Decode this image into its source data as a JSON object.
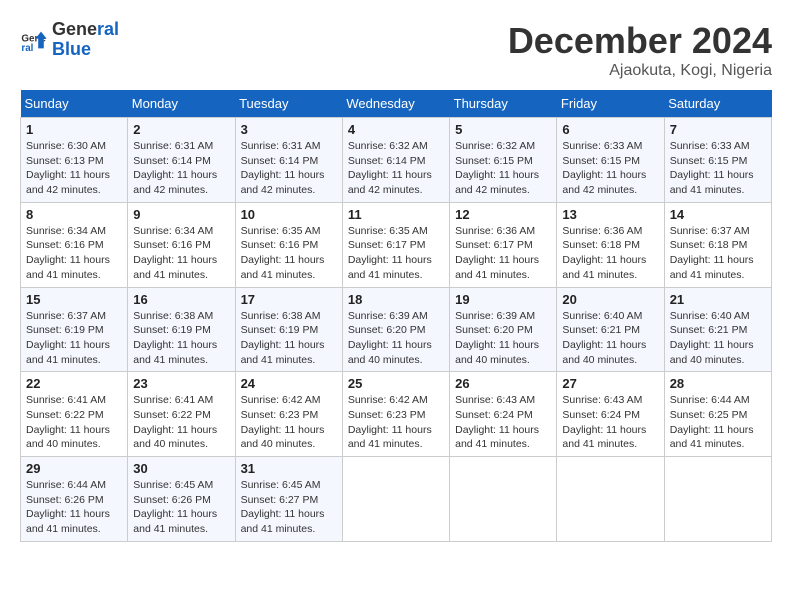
{
  "header": {
    "logo_line1": "General",
    "logo_line2": "Blue",
    "month": "December 2024",
    "location": "Ajaokuta, Kogi, Nigeria"
  },
  "weekdays": [
    "Sunday",
    "Monday",
    "Tuesday",
    "Wednesday",
    "Thursday",
    "Friday",
    "Saturday"
  ],
  "weeks": [
    [
      {
        "day": "1",
        "lines": [
          "Sunrise: 6:30 AM",
          "Sunset: 6:13 PM",
          "Daylight: 11 hours",
          "and 42 minutes."
        ]
      },
      {
        "day": "2",
        "lines": [
          "Sunrise: 6:31 AM",
          "Sunset: 6:14 PM",
          "Daylight: 11 hours",
          "and 42 minutes."
        ]
      },
      {
        "day": "3",
        "lines": [
          "Sunrise: 6:31 AM",
          "Sunset: 6:14 PM",
          "Daylight: 11 hours",
          "and 42 minutes."
        ]
      },
      {
        "day": "4",
        "lines": [
          "Sunrise: 6:32 AM",
          "Sunset: 6:14 PM",
          "Daylight: 11 hours",
          "and 42 minutes."
        ]
      },
      {
        "day": "5",
        "lines": [
          "Sunrise: 6:32 AM",
          "Sunset: 6:15 PM",
          "Daylight: 11 hours",
          "and 42 minutes."
        ]
      },
      {
        "day": "6",
        "lines": [
          "Sunrise: 6:33 AM",
          "Sunset: 6:15 PM",
          "Daylight: 11 hours",
          "and 42 minutes."
        ]
      },
      {
        "day": "7",
        "lines": [
          "Sunrise: 6:33 AM",
          "Sunset: 6:15 PM",
          "Daylight: 11 hours",
          "and 41 minutes."
        ]
      }
    ],
    [
      {
        "day": "8",
        "lines": [
          "Sunrise: 6:34 AM",
          "Sunset: 6:16 PM",
          "Daylight: 11 hours",
          "and 41 minutes."
        ]
      },
      {
        "day": "9",
        "lines": [
          "Sunrise: 6:34 AM",
          "Sunset: 6:16 PM",
          "Daylight: 11 hours",
          "and 41 minutes."
        ]
      },
      {
        "day": "10",
        "lines": [
          "Sunrise: 6:35 AM",
          "Sunset: 6:16 PM",
          "Daylight: 11 hours",
          "and 41 minutes."
        ]
      },
      {
        "day": "11",
        "lines": [
          "Sunrise: 6:35 AM",
          "Sunset: 6:17 PM",
          "Daylight: 11 hours",
          "and 41 minutes."
        ]
      },
      {
        "day": "12",
        "lines": [
          "Sunrise: 6:36 AM",
          "Sunset: 6:17 PM",
          "Daylight: 11 hours",
          "and 41 minutes."
        ]
      },
      {
        "day": "13",
        "lines": [
          "Sunrise: 6:36 AM",
          "Sunset: 6:18 PM",
          "Daylight: 11 hours",
          "and 41 minutes."
        ]
      },
      {
        "day": "14",
        "lines": [
          "Sunrise: 6:37 AM",
          "Sunset: 6:18 PM",
          "Daylight: 11 hours",
          "and 41 minutes."
        ]
      }
    ],
    [
      {
        "day": "15",
        "lines": [
          "Sunrise: 6:37 AM",
          "Sunset: 6:19 PM",
          "Daylight: 11 hours",
          "and 41 minutes."
        ]
      },
      {
        "day": "16",
        "lines": [
          "Sunrise: 6:38 AM",
          "Sunset: 6:19 PM",
          "Daylight: 11 hours",
          "and 41 minutes."
        ]
      },
      {
        "day": "17",
        "lines": [
          "Sunrise: 6:38 AM",
          "Sunset: 6:19 PM",
          "Daylight: 11 hours",
          "and 41 minutes."
        ]
      },
      {
        "day": "18",
        "lines": [
          "Sunrise: 6:39 AM",
          "Sunset: 6:20 PM",
          "Daylight: 11 hours",
          "and 40 minutes."
        ]
      },
      {
        "day": "19",
        "lines": [
          "Sunrise: 6:39 AM",
          "Sunset: 6:20 PM",
          "Daylight: 11 hours",
          "and 40 minutes."
        ]
      },
      {
        "day": "20",
        "lines": [
          "Sunrise: 6:40 AM",
          "Sunset: 6:21 PM",
          "Daylight: 11 hours",
          "and 40 minutes."
        ]
      },
      {
        "day": "21",
        "lines": [
          "Sunrise: 6:40 AM",
          "Sunset: 6:21 PM",
          "Daylight: 11 hours",
          "and 40 minutes."
        ]
      }
    ],
    [
      {
        "day": "22",
        "lines": [
          "Sunrise: 6:41 AM",
          "Sunset: 6:22 PM",
          "Daylight: 11 hours",
          "and 40 minutes."
        ]
      },
      {
        "day": "23",
        "lines": [
          "Sunrise: 6:41 AM",
          "Sunset: 6:22 PM",
          "Daylight: 11 hours",
          "and 40 minutes."
        ]
      },
      {
        "day": "24",
        "lines": [
          "Sunrise: 6:42 AM",
          "Sunset: 6:23 PM",
          "Daylight: 11 hours",
          "and 40 minutes."
        ]
      },
      {
        "day": "25",
        "lines": [
          "Sunrise: 6:42 AM",
          "Sunset: 6:23 PM",
          "Daylight: 11 hours",
          "and 41 minutes."
        ]
      },
      {
        "day": "26",
        "lines": [
          "Sunrise: 6:43 AM",
          "Sunset: 6:24 PM",
          "Daylight: 11 hours",
          "and 41 minutes."
        ]
      },
      {
        "day": "27",
        "lines": [
          "Sunrise: 6:43 AM",
          "Sunset: 6:24 PM",
          "Daylight: 11 hours",
          "and 41 minutes."
        ]
      },
      {
        "day": "28",
        "lines": [
          "Sunrise: 6:44 AM",
          "Sunset: 6:25 PM",
          "Daylight: 11 hours",
          "and 41 minutes."
        ]
      }
    ],
    [
      {
        "day": "29",
        "lines": [
          "Sunrise: 6:44 AM",
          "Sunset: 6:26 PM",
          "Daylight: 11 hours",
          "and 41 minutes."
        ]
      },
      {
        "day": "30",
        "lines": [
          "Sunrise: 6:45 AM",
          "Sunset: 6:26 PM",
          "Daylight: 11 hours",
          "and 41 minutes."
        ]
      },
      {
        "day": "31",
        "lines": [
          "Sunrise: 6:45 AM",
          "Sunset: 6:27 PM",
          "Daylight: 11 hours",
          "and 41 minutes."
        ]
      },
      null,
      null,
      null,
      null
    ]
  ]
}
